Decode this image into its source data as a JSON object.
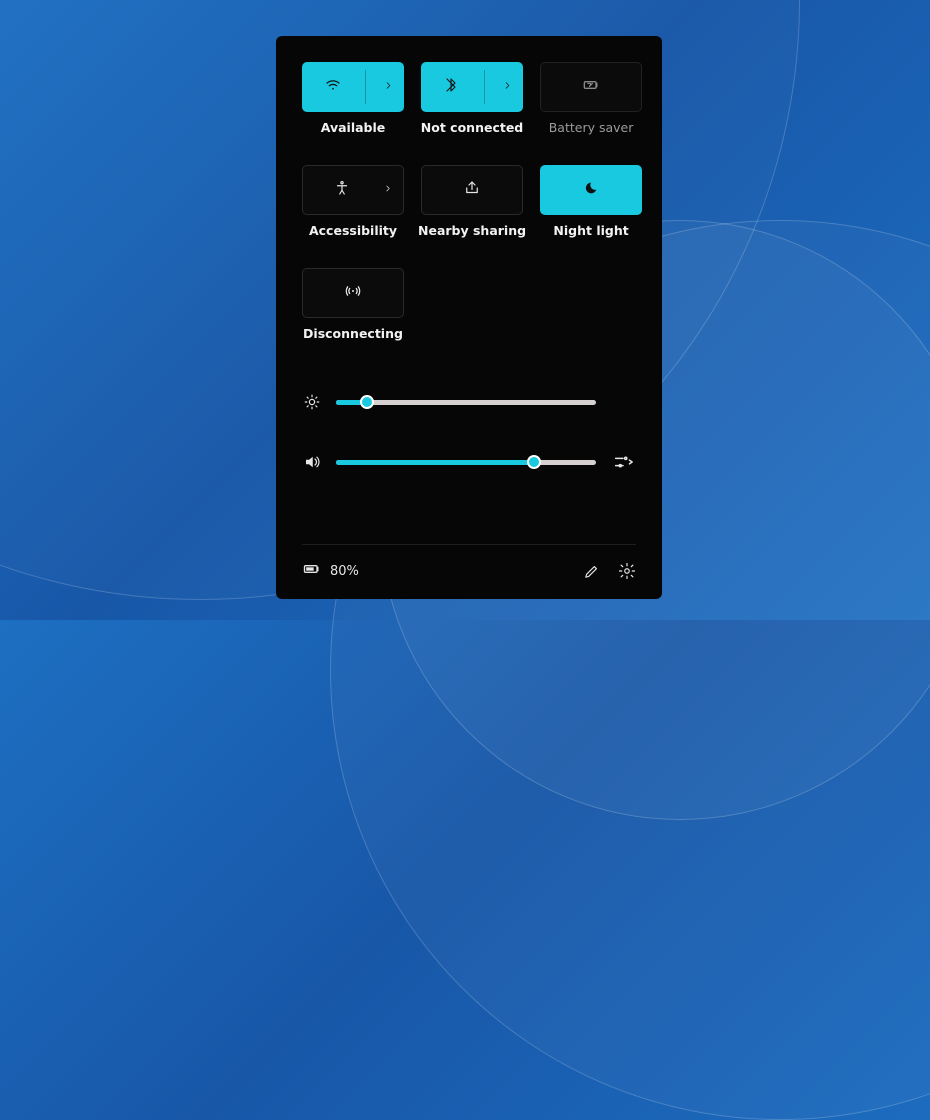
{
  "accent": "#18c9e0",
  "tiles": [
    {
      "icon": "wifi",
      "label": "Available",
      "active": true,
      "chevron": true,
      "dim": false
    },
    {
      "icon": "bluetooth",
      "label": "Not connected",
      "active": true,
      "chevron": true,
      "dim": false
    },
    {
      "icon": "battery",
      "label": "Battery saver",
      "active": false,
      "chevron": false,
      "dim": true
    },
    {
      "icon": "access",
      "label": "Accessibility",
      "active": false,
      "chevron": true,
      "dim": false
    },
    {
      "icon": "share",
      "label": "Nearby sharing",
      "active": false,
      "chevron": false,
      "dim": false
    },
    {
      "icon": "moon",
      "label": "Night light",
      "active": true,
      "chevron": false,
      "dim": false
    },
    {
      "icon": "hotspot",
      "label": "Disconnecting",
      "active": false,
      "chevron": false,
      "dim": false
    }
  ],
  "sliders": {
    "brightness": {
      "value": 12
    },
    "volume": {
      "value": 76
    }
  },
  "footer": {
    "battery_pct": "80%"
  }
}
